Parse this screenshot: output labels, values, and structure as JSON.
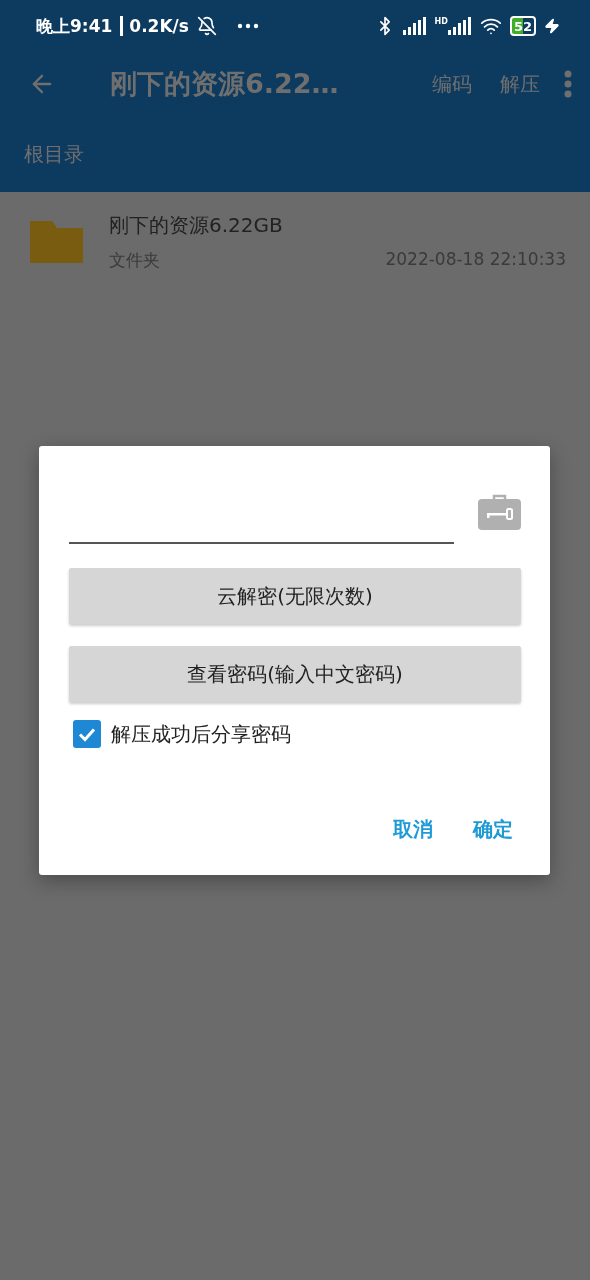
{
  "status_bar": {
    "time": "晚上9:41",
    "speed": "0.2K/s",
    "network_label": "HD",
    "battery": "52"
  },
  "toolbar": {
    "title": "刚下的资源6.22…",
    "actions": [
      "编码",
      "解压"
    ]
  },
  "breadcrumb": "根目录",
  "files": [
    {
      "name": "刚下的资源6.22GB",
      "type": "文件夹",
      "date": "2022-08-18 22:10:33"
    }
  ],
  "dialog": {
    "buttons": [
      "云解密(无限次数)",
      "查看密码(输入中文密码)"
    ],
    "checkbox": {
      "label": "解压成功后分享密码",
      "checked": true
    },
    "actions": [
      "取消",
      "确定"
    ]
  }
}
